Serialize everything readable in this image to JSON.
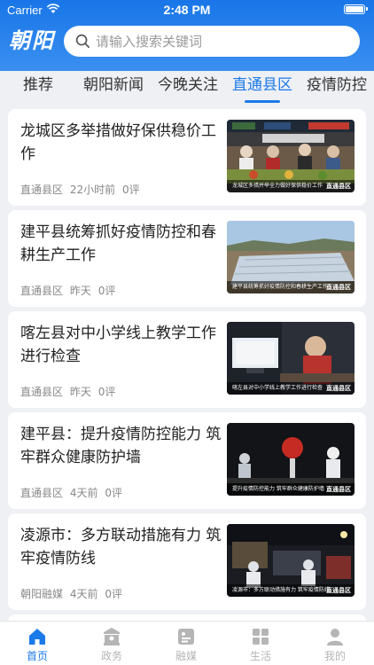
{
  "status_bar": {
    "carrier": "Carrier",
    "time": "2:48 PM"
  },
  "header": {
    "logo": "朝阳",
    "search_placeholder": "请输入搜索关键词"
  },
  "tabs": [
    {
      "label": "推荐",
      "active": false
    },
    {
      "label": "朝阳新闻",
      "active": false
    },
    {
      "label": "今晚关注",
      "active": false
    },
    {
      "label": "直通县区",
      "active": true
    },
    {
      "label": "疫情防控",
      "active": false
    }
  ],
  "articles": [
    {
      "title": "龙城区多举措做好保供稳价工作",
      "source": "直通县区",
      "time": "22小时前",
      "comments": "0评",
      "thumb_caption": "龙城区多措并举全力做好保供稳价工作",
      "thumb_tag": "直通县区"
    },
    {
      "title": "建平县统筹抓好疫情防控和春耕生产工作",
      "source": "直通县区",
      "time": "昨天",
      "comments": "0评",
      "thumb_caption": "建平县统筹抓好疫情防控和春耕生产工作",
      "thumb_tag": "直通县区"
    },
    {
      "title": "喀左县对中小学线上教学工作进行检查",
      "source": "直通县区",
      "time": "昨天",
      "comments": "0评",
      "thumb_caption": "喀左县对中小学线上教学工作进行检查",
      "thumb_tag": "直通县区"
    },
    {
      "title": "建平县：提升疫情防控能力 筑牢群众健康防护墙",
      "source": "直通县区",
      "time": "4天前",
      "comments": "0评",
      "thumb_caption": "提升疫情防控能力 筑牢群众健康防护墙",
      "thumb_tag": "直通县区"
    },
    {
      "title": "凌源市：多方联动措施有力 筑牢疫情防线",
      "source": "朝阳融媒",
      "time": "4天前",
      "comments": "0评",
      "thumb_caption": "凌源市：多方联动措施有力 筑牢疫情防线",
      "thumb_tag": "直通县区"
    }
  ],
  "tabbar": [
    {
      "label": "首页",
      "icon": "home-icon",
      "active": true
    },
    {
      "label": "政务",
      "icon": "government-icon",
      "active": false
    },
    {
      "label": "融媒",
      "icon": "media-icon",
      "active": false
    },
    {
      "label": "生活",
      "icon": "grid-icon",
      "active": false
    },
    {
      "label": "我的",
      "icon": "user-icon",
      "active": false
    }
  ],
  "colors": {
    "primary": "#1c7ae8",
    "header_top": "#1976e8",
    "background": "#eef0f4",
    "inactive": "#b5b5b5"
  }
}
